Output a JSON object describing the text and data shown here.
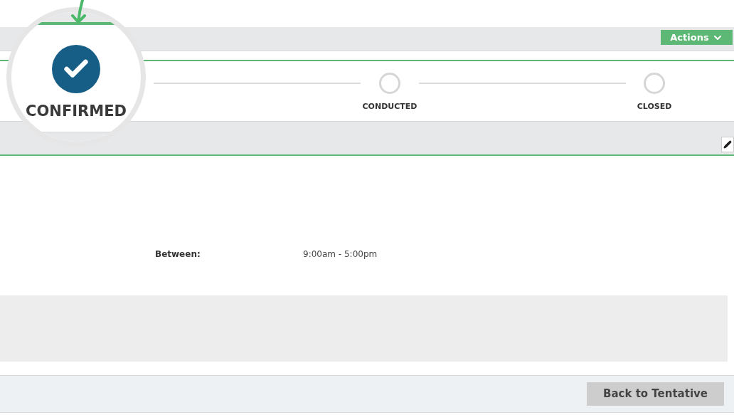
{
  "header": {
    "actions_button": "Actions"
  },
  "steps": [
    {
      "label": "CONFIRMED",
      "done": true
    },
    {
      "label": "CONDUCTED",
      "done": false
    },
    {
      "label": "CLOSED",
      "done": false
    }
  ],
  "details": [
    {
      "label": "Between:",
      "value": "9:00am - 5:00pm"
    }
  ],
  "footer": {
    "button": "Back to Tentative"
  }
}
